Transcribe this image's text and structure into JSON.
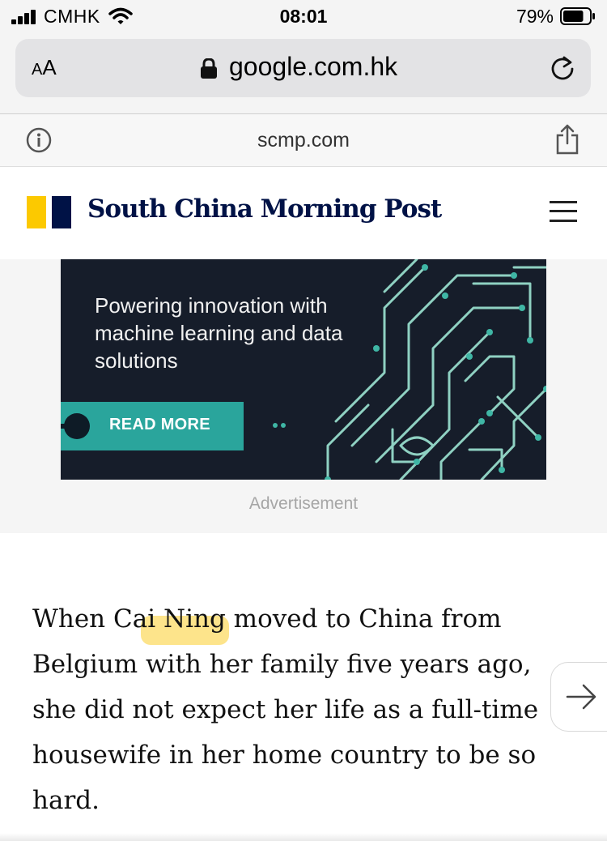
{
  "status_bar": {
    "carrier": "CMHK",
    "time": "08:01",
    "battery_percent": "79%",
    "battery_level": 0.79
  },
  "browser": {
    "text_size_label_small": "A",
    "text_size_label_large": "A",
    "url": "google.com.hk",
    "site_domain": "scmp.com"
  },
  "site_header": {
    "brand_name": "South China Morning Post",
    "logo_colors": [
      "#fcc900",
      "#001246"
    ]
  },
  "advertisement": {
    "headline": "Powering innovation with machine learning and data solutions",
    "cta_label": "READ MORE",
    "label": "Advertisement",
    "accent_color": "#2aa59c"
  },
  "article": {
    "paragraph_before": "When C",
    "highlighted": "ai Ning",
    "paragraph_after": " moved to China from Belgium with her family five years ago, she did not expect her life as a full-time housewife in her home country to be so hard."
  },
  "icons": [
    "signal-icon",
    "wifi-icon",
    "battery-icon",
    "lock-icon",
    "reload-icon",
    "info-icon",
    "share-icon",
    "hamburger-menu-icon",
    "arrow-right-icon"
  ]
}
